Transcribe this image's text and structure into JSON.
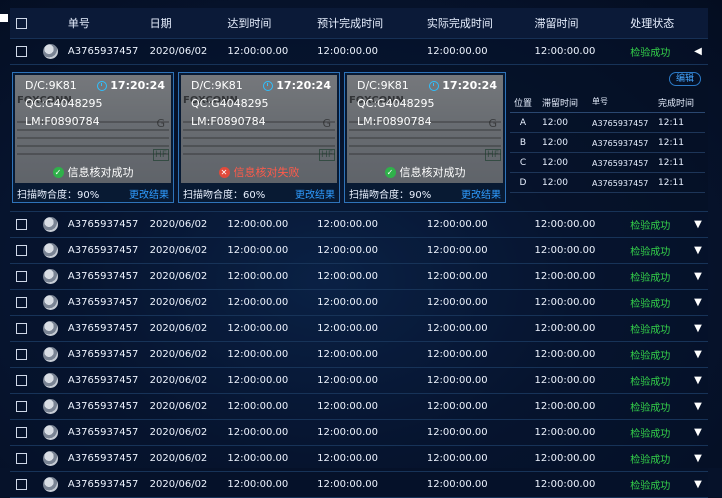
{
  "headers": {
    "no": "单号",
    "date": "日期",
    "arrive": "达到时间",
    "plan": "预计完成时间",
    "actual": "实际完成时间",
    "stay": "滞留时间",
    "status": "处理状态"
  },
  "rows": [
    {
      "no": "A3765937457",
      "date": "2020/06/02",
      "arrive": "12:00:00.00",
      "plan": "12:00:00.00",
      "actual": "12:00:00.00",
      "stay": "12:00:00.00",
      "status": "检验成功"
    },
    {
      "no": "A3765937457",
      "date": "2020/06/02",
      "arrive": "12:00:00.00",
      "plan": "12:00:00.00",
      "actual": "12:00:00.00",
      "stay": "12:00:00.00",
      "status": "检验成功"
    },
    {
      "no": "A3765937457",
      "date": "2020/06/02",
      "arrive": "12:00:00.00",
      "plan": "12:00:00.00",
      "actual": "12:00:00.00",
      "stay": "12:00:00.00",
      "status": "检验成功"
    },
    {
      "no": "A3765937457",
      "date": "2020/06/02",
      "arrive": "12:00:00.00",
      "plan": "12:00:00.00",
      "actual": "12:00:00.00",
      "stay": "12:00:00.00",
      "status": "检验成功"
    },
    {
      "no": "A3765937457",
      "date": "2020/06/02",
      "arrive": "12:00:00.00",
      "plan": "12:00:00.00",
      "actual": "12:00:00.00",
      "stay": "12:00:00.00",
      "status": "检验成功"
    },
    {
      "no": "A3765937457",
      "date": "2020/06/02",
      "arrive": "12:00:00.00",
      "plan": "12:00:00.00",
      "actual": "12:00:00.00",
      "stay": "12:00:00.00",
      "status": "检验成功"
    },
    {
      "no": "A3765937457",
      "date": "2020/06/02",
      "arrive": "12:00:00.00",
      "plan": "12:00:00.00",
      "actual": "12:00:00.00",
      "stay": "12:00:00.00",
      "status": "检验成功"
    },
    {
      "no": "A3765937457",
      "date": "2020/06/02",
      "arrive": "12:00:00.00",
      "plan": "12:00:00.00",
      "actual": "12:00:00.00",
      "stay": "12:00:00.00",
      "status": "检验成功"
    },
    {
      "no": "A3765937457",
      "date": "2020/06/02",
      "arrive": "12:00:00.00",
      "plan": "12:00:00.00",
      "actual": "12:00:00.00",
      "stay": "12:00:00.00",
      "status": "检验成功"
    },
    {
      "no": "A3765937457",
      "date": "2020/06/02",
      "arrive": "12:00:00.00",
      "plan": "12:00:00.00",
      "actual": "12:00:00.00",
      "stay": "12:00:00.00",
      "status": "检验成功"
    },
    {
      "no": "A3765937457",
      "date": "2020/06/02",
      "arrive": "12:00:00.00",
      "plan": "12:00:00.00",
      "actual": "12:00:00.00",
      "stay": "12:00:00.00",
      "status": "检验成功"
    },
    {
      "no": "A3765937457",
      "date": "2020/06/02",
      "arrive": "12:00:00.00",
      "plan": "12:00:00.00",
      "actual": "12:00:00.00",
      "stay": "12:00:00.00",
      "status": "检验成功"
    }
  ],
  "cards": [
    {
      "dc": "D/C:9K81",
      "qc": "QC:G4048295",
      "lm": "LM:F0890784",
      "time": "17:20:24",
      "status": "信息核对成功",
      "rate": "扫描吻合度：90%",
      "change": "更改结果",
      "logo": "FOXCONN",
      "mark": "HF",
      "g": "G"
    },
    {
      "dc": "D/C:9K81",
      "qc": "QC:G4048295",
      "lm": "LM:F0890784",
      "time": "17:20:24",
      "status": "信息核对失败",
      "rate": "扫描吻合度：60%",
      "change": "更改结果",
      "logo": "FOXCONN",
      "mark": "HF",
      "g": "G"
    },
    {
      "dc": "D/C:9K81",
      "qc": "QC:G4048295",
      "lm": "LM:F0890784",
      "time": "17:20:24",
      "status": "信息核对成功",
      "rate": "扫描吻合度：90%",
      "change": "更改结果",
      "logo": "FOXCONN",
      "mark": "HF",
      "g": "G"
    }
  ],
  "side": {
    "edit": "编辑",
    "headers": {
      "pos": "位置",
      "stay": "滞留时间",
      "no": "单号",
      "finish": "完成时间"
    },
    "rows": [
      {
        "pos": "A",
        "stay": "12:00",
        "no": "A3765937457",
        "finish": "12:11"
      },
      {
        "pos": "B",
        "stay": "12:00",
        "no": "A3765937457",
        "finish": "12:11"
      },
      {
        "pos": "C",
        "stay": "12:00",
        "no": "A3765937457",
        "finish": "12:11"
      },
      {
        "pos": "D",
        "stay": "12:00",
        "no": "A3765937457",
        "finish": "12:11"
      }
    ]
  },
  "icons": {
    "expanded": "caret-left-icon",
    "collapsed": "caret-down-icon",
    "ok": "check-circle-icon",
    "fail": "x-circle-icon",
    "clock": "clock-icon"
  },
  "colors": {
    "success": "#34d24a",
    "fail": "#ff5a4a",
    "link": "#2f9cff",
    "accent": "#2e73b9"
  }
}
